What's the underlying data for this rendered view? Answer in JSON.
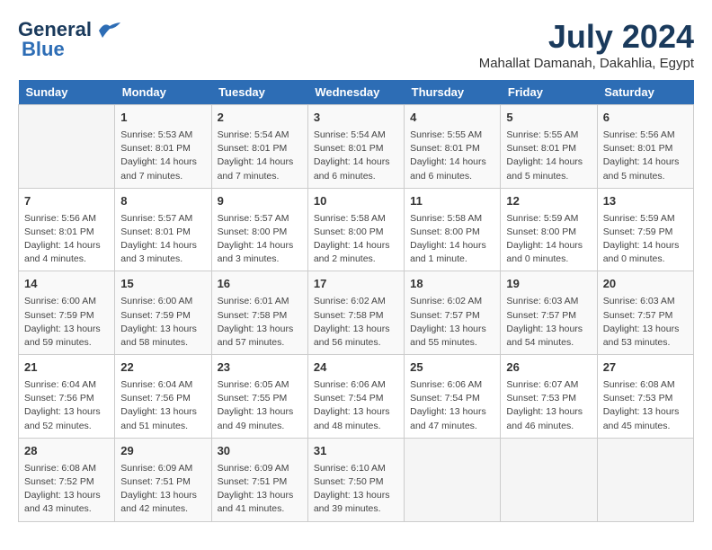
{
  "logo": {
    "line1": "General",
    "line2": "Blue"
  },
  "title": "July 2024",
  "subtitle": "Mahallat Damanah, Dakahlia, Egypt",
  "days_of_week": [
    "Sunday",
    "Monday",
    "Tuesday",
    "Wednesday",
    "Thursday",
    "Friday",
    "Saturday"
  ],
  "weeks": [
    [
      {
        "day": "",
        "info": ""
      },
      {
        "day": "1",
        "info": "Sunrise: 5:53 AM\nSunset: 8:01 PM\nDaylight: 14 hours\nand 7 minutes."
      },
      {
        "day": "2",
        "info": "Sunrise: 5:54 AM\nSunset: 8:01 PM\nDaylight: 14 hours\nand 7 minutes."
      },
      {
        "day": "3",
        "info": "Sunrise: 5:54 AM\nSunset: 8:01 PM\nDaylight: 14 hours\nand 6 minutes."
      },
      {
        "day": "4",
        "info": "Sunrise: 5:55 AM\nSunset: 8:01 PM\nDaylight: 14 hours\nand 6 minutes."
      },
      {
        "day": "5",
        "info": "Sunrise: 5:55 AM\nSunset: 8:01 PM\nDaylight: 14 hours\nand 5 minutes."
      },
      {
        "day": "6",
        "info": "Sunrise: 5:56 AM\nSunset: 8:01 PM\nDaylight: 14 hours\nand 5 minutes."
      }
    ],
    [
      {
        "day": "7",
        "info": "Sunrise: 5:56 AM\nSunset: 8:01 PM\nDaylight: 14 hours\nand 4 minutes."
      },
      {
        "day": "8",
        "info": "Sunrise: 5:57 AM\nSunset: 8:01 PM\nDaylight: 14 hours\nand 3 minutes."
      },
      {
        "day": "9",
        "info": "Sunrise: 5:57 AM\nSunset: 8:00 PM\nDaylight: 14 hours\nand 3 minutes."
      },
      {
        "day": "10",
        "info": "Sunrise: 5:58 AM\nSunset: 8:00 PM\nDaylight: 14 hours\nand 2 minutes."
      },
      {
        "day": "11",
        "info": "Sunrise: 5:58 AM\nSunset: 8:00 PM\nDaylight: 14 hours\nand 1 minute."
      },
      {
        "day": "12",
        "info": "Sunrise: 5:59 AM\nSunset: 8:00 PM\nDaylight: 14 hours\nand 0 minutes."
      },
      {
        "day": "13",
        "info": "Sunrise: 5:59 AM\nSunset: 7:59 PM\nDaylight: 14 hours\nand 0 minutes."
      }
    ],
    [
      {
        "day": "14",
        "info": "Sunrise: 6:00 AM\nSunset: 7:59 PM\nDaylight: 13 hours\nand 59 minutes."
      },
      {
        "day": "15",
        "info": "Sunrise: 6:00 AM\nSunset: 7:59 PM\nDaylight: 13 hours\nand 58 minutes."
      },
      {
        "day": "16",
        "info": "Sunrise: 6:01 AM\nSunset: 7:58 PM\nDaylight: 13 hours\nand 57 minutes."
      },
      {
        "day": "17",
        "info": "Sunrise: 6:02 AM\nSunset: 7:58 PM\nDaylight: 13 hours\nand 56 minutes."
      },
      {
        "day": "18",
        "info": "Sunrise: 6:02 AM\nSunset: 7:57 PM\nDaylight: 13 hours\nand 55 minutes."
      },
      {
        "day": "19",
        "info": "Sunrise: 6:03 AM\nSunset: 7:57 PM\nDaylight: 13 hours\nand 54 minutes."
      },
      {
        "day": "20",
        "info": "Sunrise: 6:03 AM\nSunset: 7:57 PM\nDaylight: 13 hours\nand 53 minutes."
      }
    ],
    [
      {
        "day": "21",
        "info": "Sunrise: 6:04 AM\nSunset: 7:56 PM\nDaylight: 13 hours\nand 52 minutes."
      },
      {
        "day": "22",
        "info": "Sunrise: 6:04 AM\nSunset: 7:56 PM\nDaylight: 13 hours\nand 51 minutes."
      },
      {
        "day": "23",
        "info": "Sunrise: 6:05 AM\nSunset: 7:55 PM\nDaylight: 13 hours\nand 49 minutes."
      },
      {
        "day": "24",
        "info": "Sunrise: 6:06 AM\nSunset: 7:54 PM\nDaylight: 13 hours\nand 48 minutes."
      },
      {
        "day": "25",
        "info": "Sunrise: 6:06 AM\nSunset: 7:54 PM\nDaylight: 13 hours\nand 47 minutes."
      },
      {
        "day": "26",
        "info": "Sunrise: 6:07 AM\nSunset: 7:53 PM\nDaylight: 13 hours\nand 46 minutes."
      },
      {
        "day": "27",
        "info": "Sunrise: 6:08 AM\nSunset: 7:53 PM\nDaylight: 13 hours\nand 45 minutes."
      }
    ],
    [
      {
        "day": "28",
        "info": "Sunrise: 6:08 AM\nSunset: 7:52 PM\nDaylight: 13 hours\nand 43 minutes."
      },
      {
        "day": "29",
        "info": "Sunrise: 6:09 AM\nSunset: 7:51 PM\nDaylight: 13 hours\nand 42 minutes."
      },
      {
        "day": "30",
        "info": "Sunrise: 6:09 AM\nSunset: 7:51 PM\nDaylight: 13 hours\nand 41 minutes."
      },
      {
        "day": "31",
        "info": "Sunrise: 6:10 AM\nSunset: 7:50 PM\nDaylight: 13 hours\nand 39 minutes."
      },
      {
        "day": "",
        "info": ""
      },
      {
        "day": "",
        "info": ""
      },
      {
        "day": "",
        "info": ""
      }
    ]
  ]
}
